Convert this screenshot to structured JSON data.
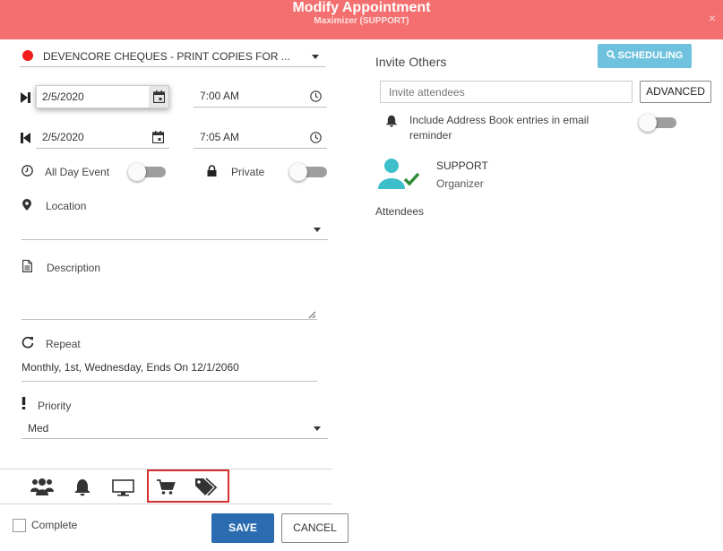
{
  "dialog": {
    "title": "Modify Appointment",
    "subtitle": "Maximizer (SUPPORT)",
    "close_glyph": "×"
  },
  "category": {
    "value": "DEVENCORE CHEQUES - PRINT COPIES FOR ...",
    "color": "#f31c1c"
  },
  "start": {
    "date": "2/5/2020",
    "time": "7:00 AM"
  },
  "end": {
    "date": "2/5/2020",
    "time": "7:05 AM"
  },
  "all_day": {
    "label": "All Day Event"
  },
  "private": {
    "label": "Private"
  },
  "location": {
    "label": "Location",
    "value": ""
  },
  "description": {
    "label": "Description",
    "value": ""
  },
  "repeat": {
    "label": "Repeat",
    "value": "Monthly, 1st, Wednesday, Ends On 12/1/2060"
  },
  "priority": {
    "label": "Priority",
    "value": "Med"
  },
  "tabs": [
    {
      "icon": "users-icon"
    },
    {
      "icon": "bell-icon"
    },
    {
      "icon": "monitor-icon"
    },
    {
      "icon": "cart-icon"
    },
    {
      "icon": "tags-icon"
    }
  ],
  "footer": {
    "complete_label": "Complete",
    "save_label": "SAVE",
    "cancel_label": "CANCEL"
  },
  "invite": {
    "heading": "Invite Others",
    "scheduling_label": "SCHEDULING",
    "placeholder": "Invite attendees",
    "advanced_label": "ADVANCED",
    "address_book_label": "Include Address Book entries in email reminder",
    "organizer_name": "SUPPORT",
    "organizer_role": "Organizer",
    "attendees_label": "Attendees"
  },
  "colors": {
    "header": "#f46f6f",
    "save": "#2b6cb0",
    "scheduling": "#6fc2de",
    "avatar": "#3cbfca",
    "check": "#2e8b3a",
    "highlight": "#d32f2f"
  }
}
